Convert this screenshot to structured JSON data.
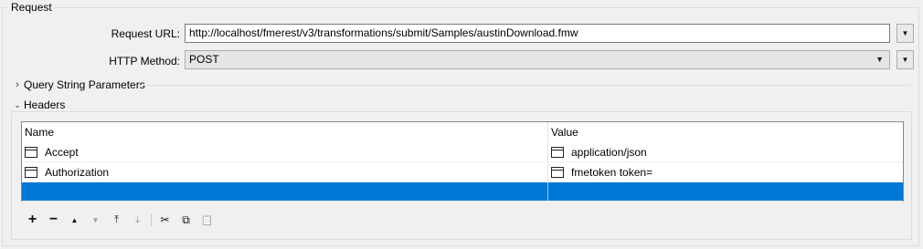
{
  "group_title": "Request",
  "request_url": {
    "label": "Request URL:",
    "value": "http://localhost/fmerest/v3/transformations/submit/Samples/austinDownload.fmw"
  },
  "http_method": {
    "label": "HTTP Method:",
    "value": "POST"
  },
  "query_params": {
    "label": "Query String Parameters",
    "expanded": false
  },
  "headers": {
    "label": "Headers",
    "expanded": true,
    "columns": [
      "Name",
      "Value"
    ],
    "rows": [
      {
        "name": "Accept",
        "value": "application/json"
      },
      {
        "name": "Authorization",
        "value": "fmetoken token="
      }
    ]
  },
  "toolbar": {
    "add": "+",
    "remove": "−",
    "up": "▲",
    "down": "▼",
    "top": "⤒",
    "bottom": "⤓",
    "cut": "✂",
    "copy": "⧉",
    "paste": "📋"
  },
  "colors": {
    "selection": "#0078d7",
    "background": "#f0f0f0"
  },
  "icons": {
    "dropdown": "triangle-down-icon",
    "collapsed": "chevron-right-icon",
    "expanded": "chevron-down-icon",
    "cell": "text-field-icon"
  }
}
